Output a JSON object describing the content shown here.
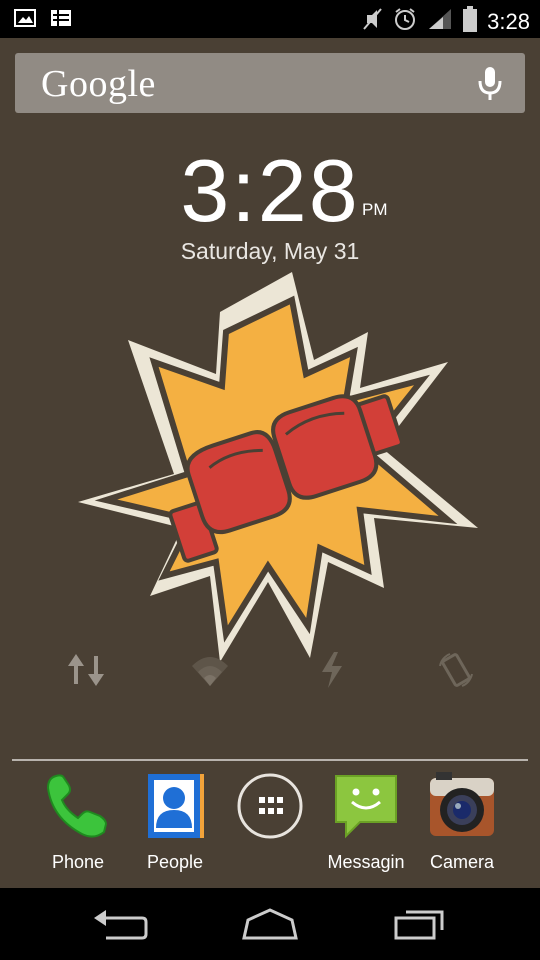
{
  "status_bar": {
    "time": "3:28",
    "left_icons": [
      "gallery-icon",
      "notification-list-icon"
    ],
    "right_icons": [
      "mute-icon",
      "alarm-icon",
      "signal-icon",
      "battery-icon"
    ]
  },
  "search": {
    "logo": "Google",
    "mic_icon": "microphone-icon"
  },
  "clock": {
    "time": "3:28",
    "ampm": "PM",
    "date": "Saturday, May 31"
  },
  "quick_settings": [
    "data-icon",
    "wifi-icon",
    "flash-icon",
    "rotate-icon"
  ],
  "dock": {
    "phone": "Phone",
    "people": "People",
    "messaging": "Messagin",
    "camera": "Camera"
  },
  "nav": [
    "back-icon",
    "home-icon",
    "recents-icon"
  ],
  "colors": {
    "background": "#4a4034",
    "accent_yellow": "#f4b042",
    "glove_red": "#d23f38",
    "burst_outline": "#ece6d6"
  }
}
